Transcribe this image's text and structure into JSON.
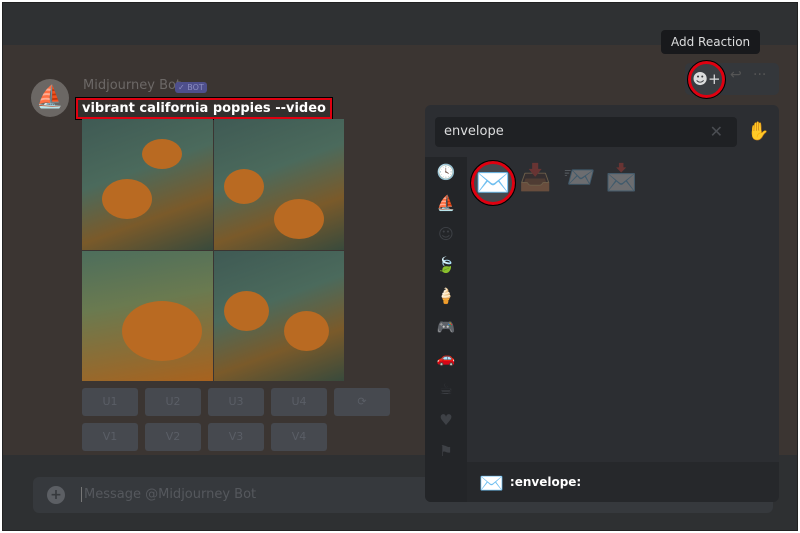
{
  "message": {
    "author": "Midjourney Bot",
    "badge": "✓ BOT",
    "prompt": "vibrant california poppies --video"
  },
  "buttons": {
    "upscale": [
      "U1",
      "U2",
      "U3",
      "U4"
    ],
    "reroll_icon": "refresh-icon",
    "reroll": "⟳",
    "variation": [
      "V1",
      "V2",
      "V3",
      "V4"
    ]
  },
  "composer": {
    "placeholder": "Message @Midjourney Bot",
    "plus": "+"
  },
  "tooltip": "Add Reaction",
  "toolbar": {
    "react": "☻+",
    "reply": "↩",
    "more": "···"
  },
  "picker": {
    "search_value": "envelope",
    "clear": "✕",
    "skin": "✋",
    "categories": [
      "🕓",
      "⛵",
      "☺",
      "🍃",
      "🍦",
      "🎮",
      "🚗",
      "☕",
      "♥",
      "⚑"
    ],
    "results": [
      "✉️",
      "📥",
      "📨",
      "📩"
    ],
    "preview_emoji": "✉️",
    "preview_name": ":envelope:"
  }
}
